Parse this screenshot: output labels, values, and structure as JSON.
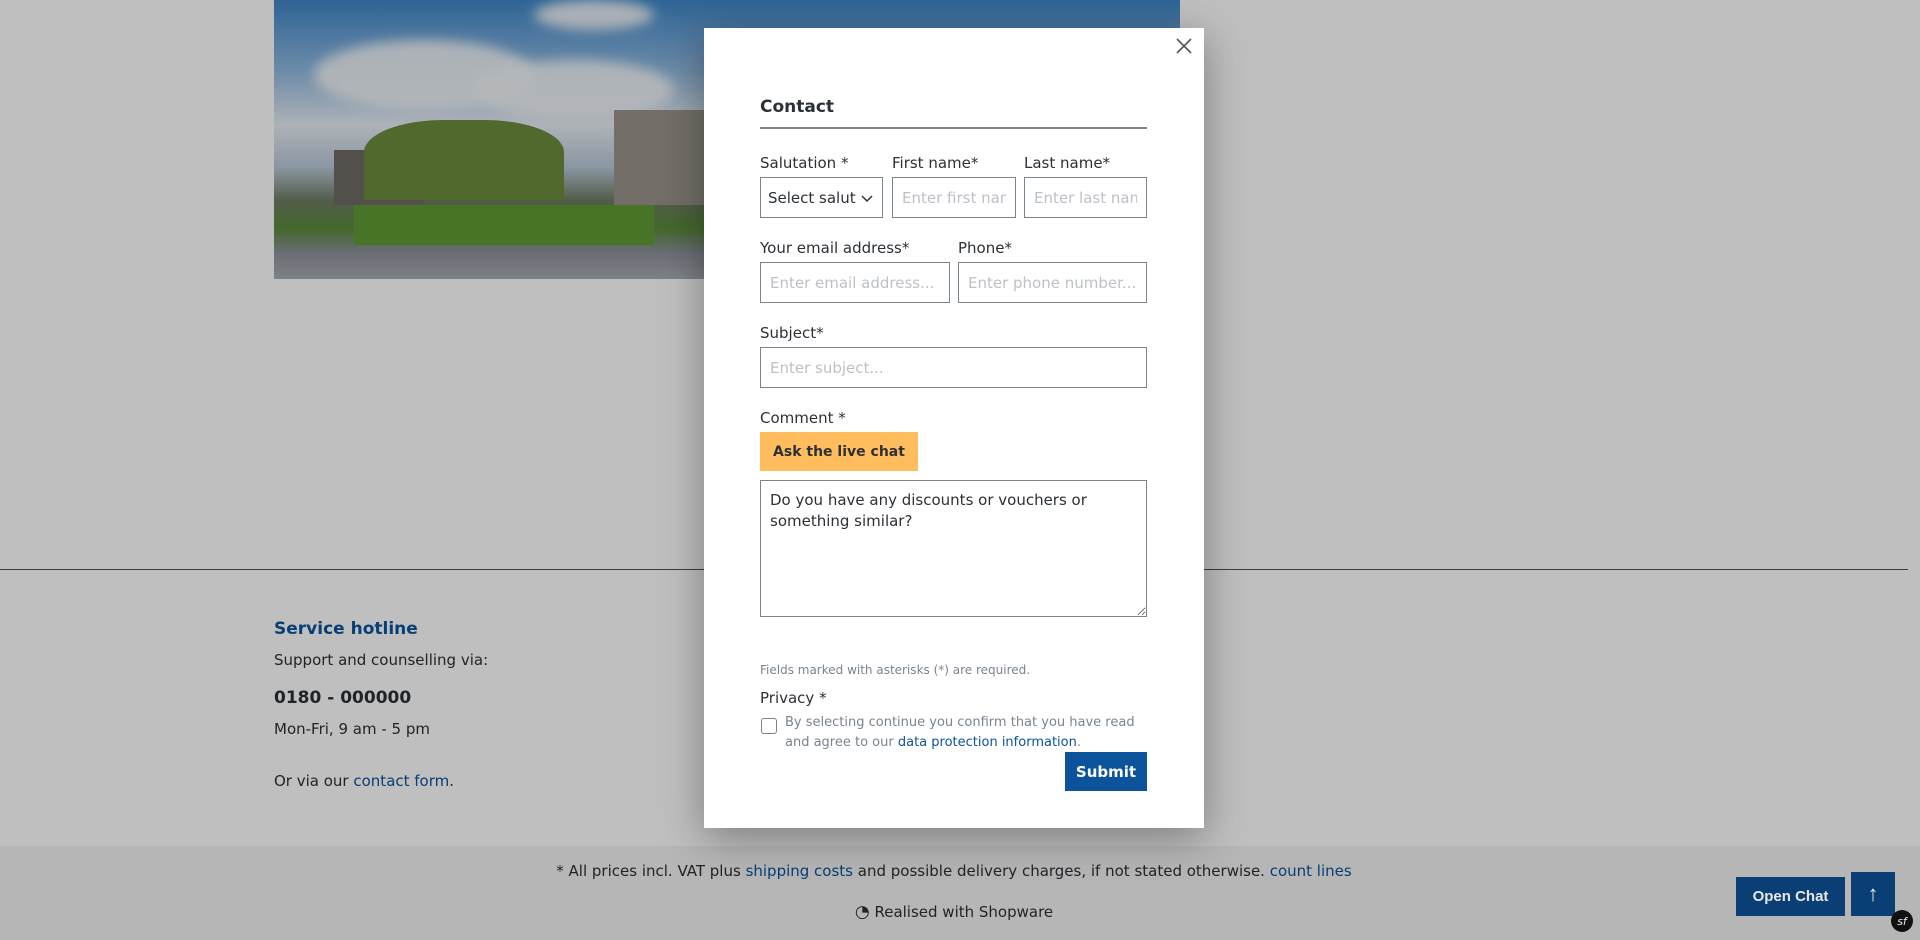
{
  "footer": {
    "hotline_title": "Service hotline",
    "support_text": "Support and counselling via:",
    "phone": "0180 - 000000",
    "hours": "Mon-Fri, 9 am - 5 pm",
    "or_via": "Or via our ",
    "contact_form_link": "contact form",
    "period": ".",
    "vat_prefix": "* All prices incl. VAT plus ",
    "shipping_link": "shipping costs",
    "vat_suffix": " and possible delivery charges, if not stated otherwise. ",
    "count_lines_link": "count lines",
    "realised": "Realised with Shopware"
  },
  "floating": {
    "open_chat": "Open Chat",
    "scroll_up": "↑",
    "sf": "sf"
  },
  "modal": {
    "title": "Contact",
    "salutation_label": "Salutation *",
    "salutation_value": "Select salutation",
    "first_name_label": "First name*",
    "first_name_placeholder": "Enter first name...",
    "last_name_label": "Last name*",
    "last_name_placeholder": "Enter last name...",
    "email_label": "Your email address*",
    "email_placeholder": "Enter email address...",
    "phone_label": "Phone*",
    "phone_placeholder": "Enter phone number...",
    "subject_label": "Subject*",
    "subject_placeholder": "Enter subject...",
    "comment_label": "Comment *",
    "ask_live_chat": "Ask the live chat",
    "comment_value": "Do you have any discounts or vouchers or something similar?",
    "required_note": "Fields marked with asterisks (*) are required.",
    "privacy_label": "Privacy *",
    "privacy_text": "By selecting continue you confirm that you have read and agree to our ",
    "privacy_link": "data protection information",
    "privacy_end": ".",
    "privacy_checked": false,
    "submit": "Submit"
  },
  "colors": {
    "primary": "#0b539b",
    "accent": "#ffbd5d",
    "chat": "#0a3f75"
  }
}
